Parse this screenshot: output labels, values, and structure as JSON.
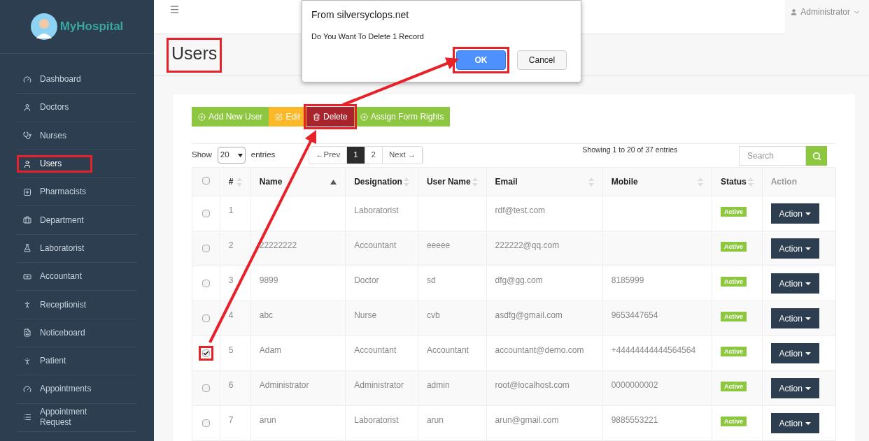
{
  "brand": {
    "name": "MyHospital"
  },
  "sidebar": {
    "items": [
      {
        "label": "Dashboard",
        "selected": false,
        "highlighted": false
      },
      {
        "label": "Doctors",
        "selected": false,
        "highlighted": false
      },
      {
        "label": "Nurses",
        "selected": false,
        "highlighted": false
      },
      {
        "label": "Users",
        "selected": true,
        "highlighted": true
      },
      {
        "label": "Pharmacists",
        "selected": false,
        "highlighted": false
      },
      {
        "label": "Department",
        "selected": false,
        "highlighted": false
      },
      {
        "label": "Laboratorist",
        "selected": false,
        "highlighted": false
      },
      {
        "label": "Accountant",
        "selected": false,
        "highlighted": false
      },
      {
        "label": "Receptionist",
        "selected": false,
        "highlighted": false
      },
      {
        "label": "Noticeboard",
        "selected": false,
        "highlighted": false
      },
      {
        "label": "Patient",
        "selected": false,
        "highlighted": false
      },
      {
        "label": "Appointments",
        "selected": false,
        "highlighted": false
      },
      {
        "label": "Appointment Request",
        "selected": false,
        "highlighted": false
      }
    ]
  },
  "topbar": {
    "user": "Administrator"
  },
  "page": {
    "title": "Users",
    "highlighted": true
  },
  "toolbar": [
    {
      "label": "Add New User",
      "kind": "add",
      "highlighted": false
    },
    {
      "label": "Edit",
      "kind": "edit",
      "highlighted": false
    },
    {
      "label": "Delete",
      "kind": "delete",
      "highlighted": true
    },
    {
      "label": "Assign Form Rights",
      "kind": "add",
      "highlighted": false
    }
  ],
  "length_menu": {
    "before": "Show",
    "value": "20",
    "after": "entries"
  },
  "pagination": [
    {
      "label": "←Prev",
      "selected": false
    },
    {
      "label": "1",
      "selected": true
    },
    {
      "label": "2",
      "selected": false
    },
    {
      "label": "Next →",
      "selected": false
    }
  ],
  "info": "Showing 1 to 20 of 37 entries",
  "search": {
    "placeholder": "Search"
  },
  "table": {
    "select_all": {
      "checked": false
    },
    "columns": [
      {
        "label": "#",
        "sortable": true,
        "sorted": false
      },
      {
        "label": "Name",
        "sortable": true,
        "sorted": true
      },
      {
        "label": "Designation",
        "sortable": true,
        "sorted": false
      },
      {
        "label": "User Name",
        "sortable": true,
        "sorted": false
      },
      {
        "label": "Email",
        "sortable": true,
        "sorted": false
      },
      {
        "label": "Mobile",
        "sortable": true,
        "sorted": false
      },
      {
        "label": "Status",
        "sortable": true,
        "sorted": false
      },
      {
        "label": "Action",
        "sortable": false,
        "sorted": false
      }
    ],
    "rows": [
      {
        "checked": false,
        "highlighted": false,
        "cells": [
          "1",
          "",
          "Laboratorist",
          "",
          "rdf@test.com",
          ""
        ],
        "status": "Active",
        "action": "Action"
      },
      {
        "checked": false,
        "highlighted": false,
        "cells": [
          "2",
          "22222222",
          "Accountant",
          "eeeee",
          "222222@qq.com",
          ""
        ],
        "status": "Active",
        "action": "Action"
      },
      {
        "checked": false,
        "highlighted": false,
        "cells": [
          "3",
          "9899",
          "Doctor",
          "sd",
          "dfg@gg.com",
          "8185999"
        ],
        "status": "Active",
        "action": "Action"
      },
      {
        "checked": false,
        "highlighted": false,
        "cells": [
          "4",
          "abc",
          "Nurse",
          "cvb",
          "asdfg@gmail.com",
          "9653447654"
        ],
        "status": "Active",
        "action": "Action"
      },
      {
        "checked": true,
        "highlighted": true,
        "cells": [
          "5",
          "Adam",
          "Accountant",
          "Accountant",
          "accountant@demo.com",
          "+44444444444564564"
        ],
        "status": "Active",
        "action": "Action"
      },
      {
        "checked": false,
        "highlighted": false,
        "cells": [
          "6",
          "Administrator",
          "Administrator",
          "admin",
          "root@localhost.com",
          "0000000002"
        ],
        "status": "Active",
        "action": "Action"
      },
      {
        "checked": false,
        "highlighted": false,
        "cells": [
          "7",
          "arun",
          "Laboratorist",
          "arun",
          "arun@gmail.com",
          "9885553221"
        ],
        "status": "Active",
        "action": "Action"
      }
    ]
  },
  "dialog": {
    "title": "From silversyclops.net",
    "message": "Do You Want To Delete 1 Record",
    "buttons": [
      {
        "label": "OK",
        "kind": "primary",
        "highlighted": true
      },
      {
        "label": "Cancel",
        "kind": "secondary",
        "highlighted": false
      }
    ]
  }
}
